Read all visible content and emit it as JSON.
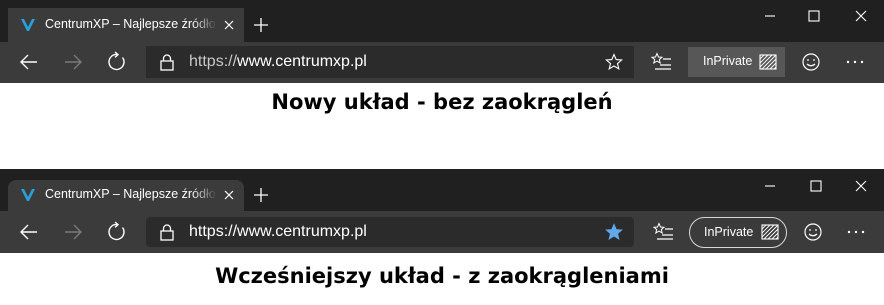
{
  "comparison": {
    "new_layout_caption": "Nowy układ - bez zaokrągleń",
    "old_layout_caption": "Wcześniejszy układ - z zaokrągleniami"
  },
  "browser": {
    "tab": {
      "title": "CentrumXP – Najlepsze źródło ze",
      "favicon": "centrumxp-logo-icon"
    },
    "address_bar": {
      "url_scheme": "https://",
      "url_host": "www.centrumxp.pl"
    },
    "inprivate_label": "InPrivate",
    "icons": {
      "back": "back-arrow-icon",
      "forward": "forward-arrow-icon",
      "refresh": "refresh-icon",
      "lock": "lock-icon",
      "favorite": "star-icon",
      "favorites_list": "favorites-list-icon",
      "feedback": "smiley-icon",
      "more": "more-ellipsis-icon",
      "minimize": "minimize-icon",
      "maximize": "maximize-icon",
      "close": "close-icon"
    },
    "colors": {
      "titlebar": "#202020",
      "toolbar": "#3b3b3b",
      "addressbar": "#2b2b2b",
      "favicon": "#2a9fd8",
      "favorite_star_filled": "#63a8e8"
    }
  }
}
